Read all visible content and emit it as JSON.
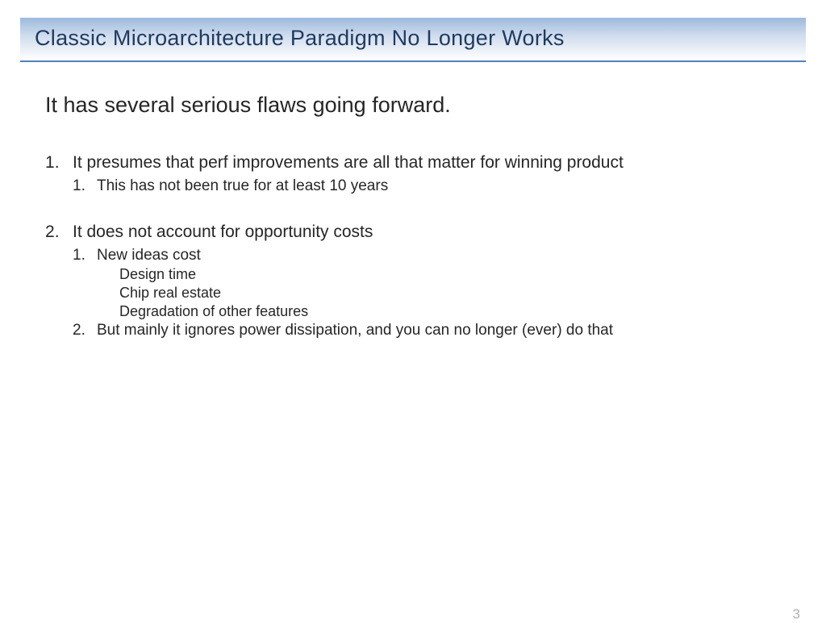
{
  "slide": {
    "title": "Classic Microarchitecture Paradigm No Longer Works",
    "lead": "It has several serious flaws going forward.",
    "points": [
      {
        "text": "It presumes that perf improvements are all that matter for winning product",
        "subpoints": [
          {
            "text": "This has not been true for at least 10 years"
          }
        ]
      },
      {
        "text": "It does not account for opportunity costs",
        "subpoints": [
          {
            "text": "New ideas cost",
            "items": [
              "Design time",
              "Chip real estate",
              "Degradation of other features"
            ]
          },
          {
            "text": "But mainly it ignores power dissipation, and you can no longer (ever) do that"
          }
        ]
      }
    ],
    "page_number": "3"
  }
}
